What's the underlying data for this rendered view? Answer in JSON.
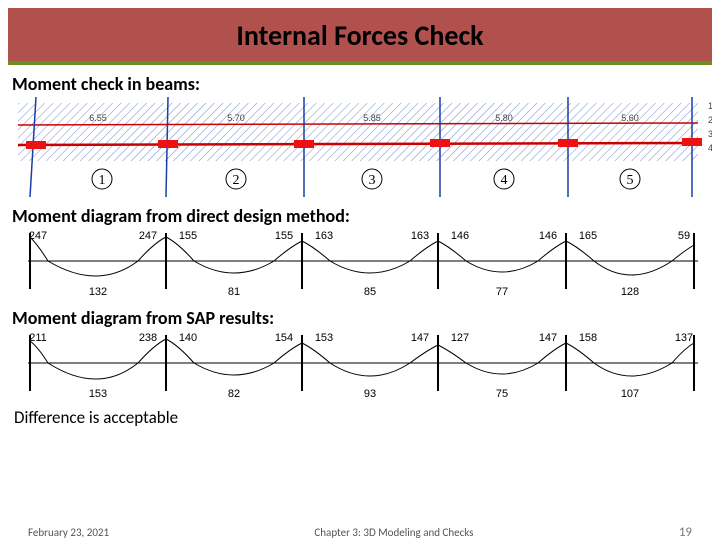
{
  "title": "Internal Forces Check",
  "section1": "Moment check in beams:",
  "section2": "Moment diagram from direct design method:",
  "section3": "Moment diagram from SAP results:",
  "conclusion": "Difference is acceptable",
  "footer": {
    "date": "February 23, 2021",
    "chapter": "Chapter 3: 3D Modeling and Checks",
    "page": "19"
  },
  "beam_plan": {
    "span_labels": [
      "1",
      "2",
      "3",
      "4",
      "5"
    ],
    "span_lengths": [
      "6.55",
      "5.70",
      "5.85",
      "5.80",
      "5.60"
    ],
    "right_scale": [
      "1",
      "2",
      "3",
      "4"
    ]
  },
  "chart_data": [
    {
      "type": "line",
      "title": "Moment diagram from direct design method",
      "xlabel": "",
      "ylabel": "",
      "spans": 5,
      "top_values": [
        247,
        247,
        155,
        155,
        163,
        163,
        146,
        146,
        165,
        59
      ],
      "bottom_values": [
        132,
        81,
        85,
        77,
        128
      ]
    },
    {
      "type": "line",
      "title": "Moment diagram from SAP results",
      "xlabel": "",
      "ylabel": "",
      "spans": 5,
      "top_values": [
        211,
        238,
        140,
        154,
        153,
        147,
        127,
        147,
        158,
        137
      ],
      "bottom_values": [
        153,
        82,
        93,
        75,
        107
      ]
    }
  ]
}
